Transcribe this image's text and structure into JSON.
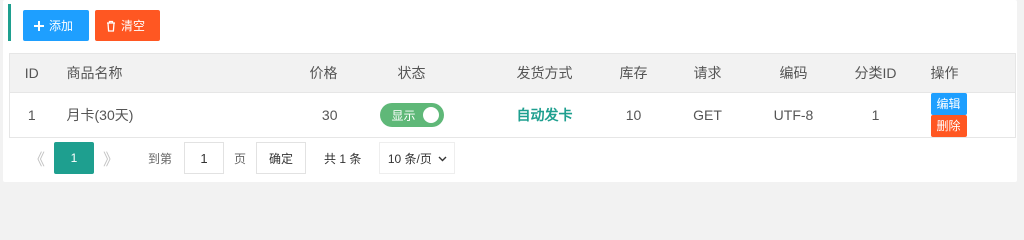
{
  "toolbar": {
    "add_label": "添加",
    "clear_label": "清空"
  },
  "table": {
    "headers": [
      "ID",
      "商品名称",
      "价格",
      "状态",
      "发货方式",
      "库存",
      "请求",
      "编码",
      "分类ID",
      "操作"
    ],
    "rows": [
      {
        "id": "1",
        "name": "月卡(30天)",
        "price": "30",
        "status": "显示",
        "ship": "自动发卡",
        "stock": "10",
        "request": "GET",
        "encoding": "UTF-8",
        "category_id": "1",
        "edit": "编辑",
        "delete": "删除"
      }
    ]
  },
  "pager": {
    "prev": "《",
    "current": "1",
    "next": "》",
    "goto_label": "到第",
    "goto_value": "1",
    "page_label": "页",
    "confirm": "确定",
    "total": "共 1 条",
    "page_size": "10 条/页"
  },
  "colors": {
    "accent": "#1e9f8f",
    "blue": "#1e9fff",
    "orange": "#ff5722",
    "green": "#5fb878"
  },
  "icons": {
    "add": "plus-icon",
    "clear": "trash-icon",
    "size_dropdown": "chevron-down-icon"
  }
}
